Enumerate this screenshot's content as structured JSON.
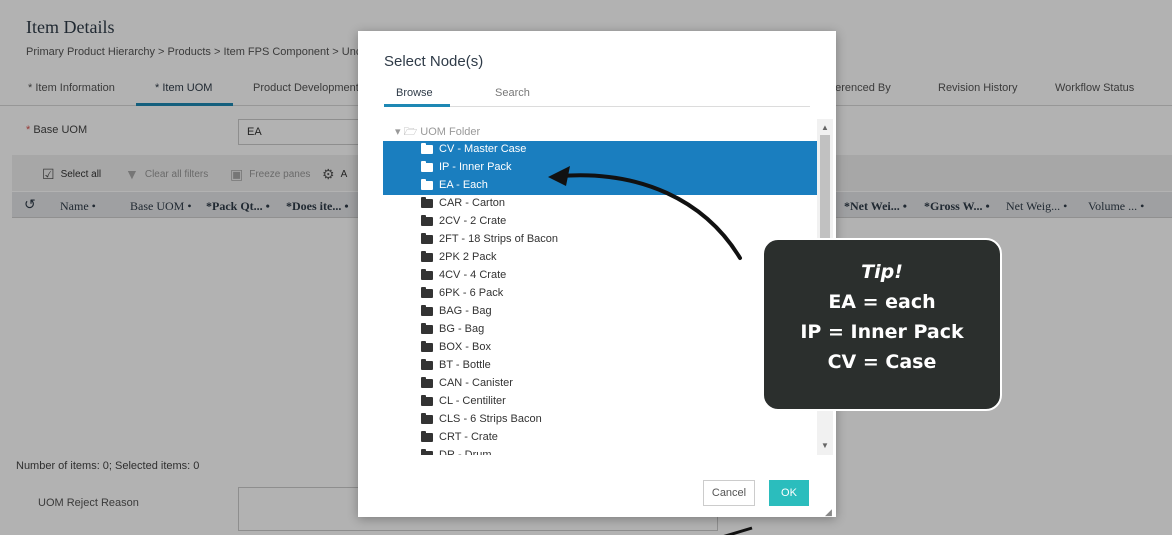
{
  "page": {
    "title": "Item Details",
    "breadcrumb": "Primary Product Hierarchy > Products > Item FPS Component > Unc",
    "tabs": [
      {
        "label": "* Item Information"
      },
      {
        "label": "* Item UOM"
      },
      {
        "label": "Product Development"
      },
      {
        "label": "Referenced By"
      },
      {
        "label": "Revision History"
      },
      {
        "label": "Workflow Status"
      }
    ],
    "base_uom_label": "Base UOM",
    "base_uom_required_mark": "*",
    "base_uom_value": "EA",
    "toolbar": {
      "select_all": "Select all",
      "clear_filters": "Clear all filters",
      "freeze_panes": "Freeze panes",
      "truncated": "A"
    },
    "grid_columns": [
      "Name •",
      "Base UOM •",
      "*Pack Qt... •",
      "*Does ite... •",
      "*Net Wei... •",
      "*Gross W... •",
      "Net Weig... •",
      "Volume ... •"
    ],
    "items_count": "Number of items: 0; Selected items: 0",
    "reject_reason_label": "UOM Reject Reason"
  },
  "modal": {
    "title": "Select Node(s)",
    "tabs": [
      {
        "label": "Browse",
        "active": true
      },
      {
        "label": "Search",
        "active": false
      }
    ],
    "root_folder": "UOM Folder",
    "nodes": [
      {
        "label": "CV - Master Case",
        "selected": true
      },
      {
        "label": "IP - Inner Pack",
        "selected": true
      },
      {
        "label": "EA - Each",
        "selected": true
      },
      {
        "label": "CAR - Carton",
        "selected": false
      },
      {
        "label": "2CV - 2 Crate",
        "selected": false
      },
      {
        "label": "2FT - 18 Strips of Bacon",
        "selected": false
      },
      {
        "label": "2PK 2 Pack",
        "selected": false
      },
      {
        "label": "4CV - 4 Crate",
        "selected": false
      },
      {
        "label": "6PK - 6 Pack",
        "selected": false
      },
      {
        "label": "BAG - Bag",
        "selected": false
      },
      {
        "label": "BG - Bag",
        "selected": false
      },
      {
        "label": "BOX - Box",
        "selected": false
      },
      {
        "label": "BT - Bottle",
        "selected": false
      },
      {
        "label": "CAN - Canister",
        "selected": false
      },
      {
        "label": "CL - Centiliter",
        "selected": false
      },
      {
        "label": "CLS - 6 Strips Bacon",
        "selected": false
      },
      {
        "label": "CRT - Crate",
        "selected": false
      },
      {
        "label": "DR - Drum",
        "selected": false
      }
    ],
    "cancel_label": "Cancel",
    "ok_label": "OK"
  },
  "tip": {
    "title": "Tip!",
    "lines": [
      "EA = each",
      "IP = Inner Pack",
      "CV = Case"
    ]
  },
  "colors": {
    "selection": "#1a7ebf",
    "accent": "#1e88b4",
    "ok_button": "#2bbdbd",
    "tip_background": "#2b2f2d"
  }
}
